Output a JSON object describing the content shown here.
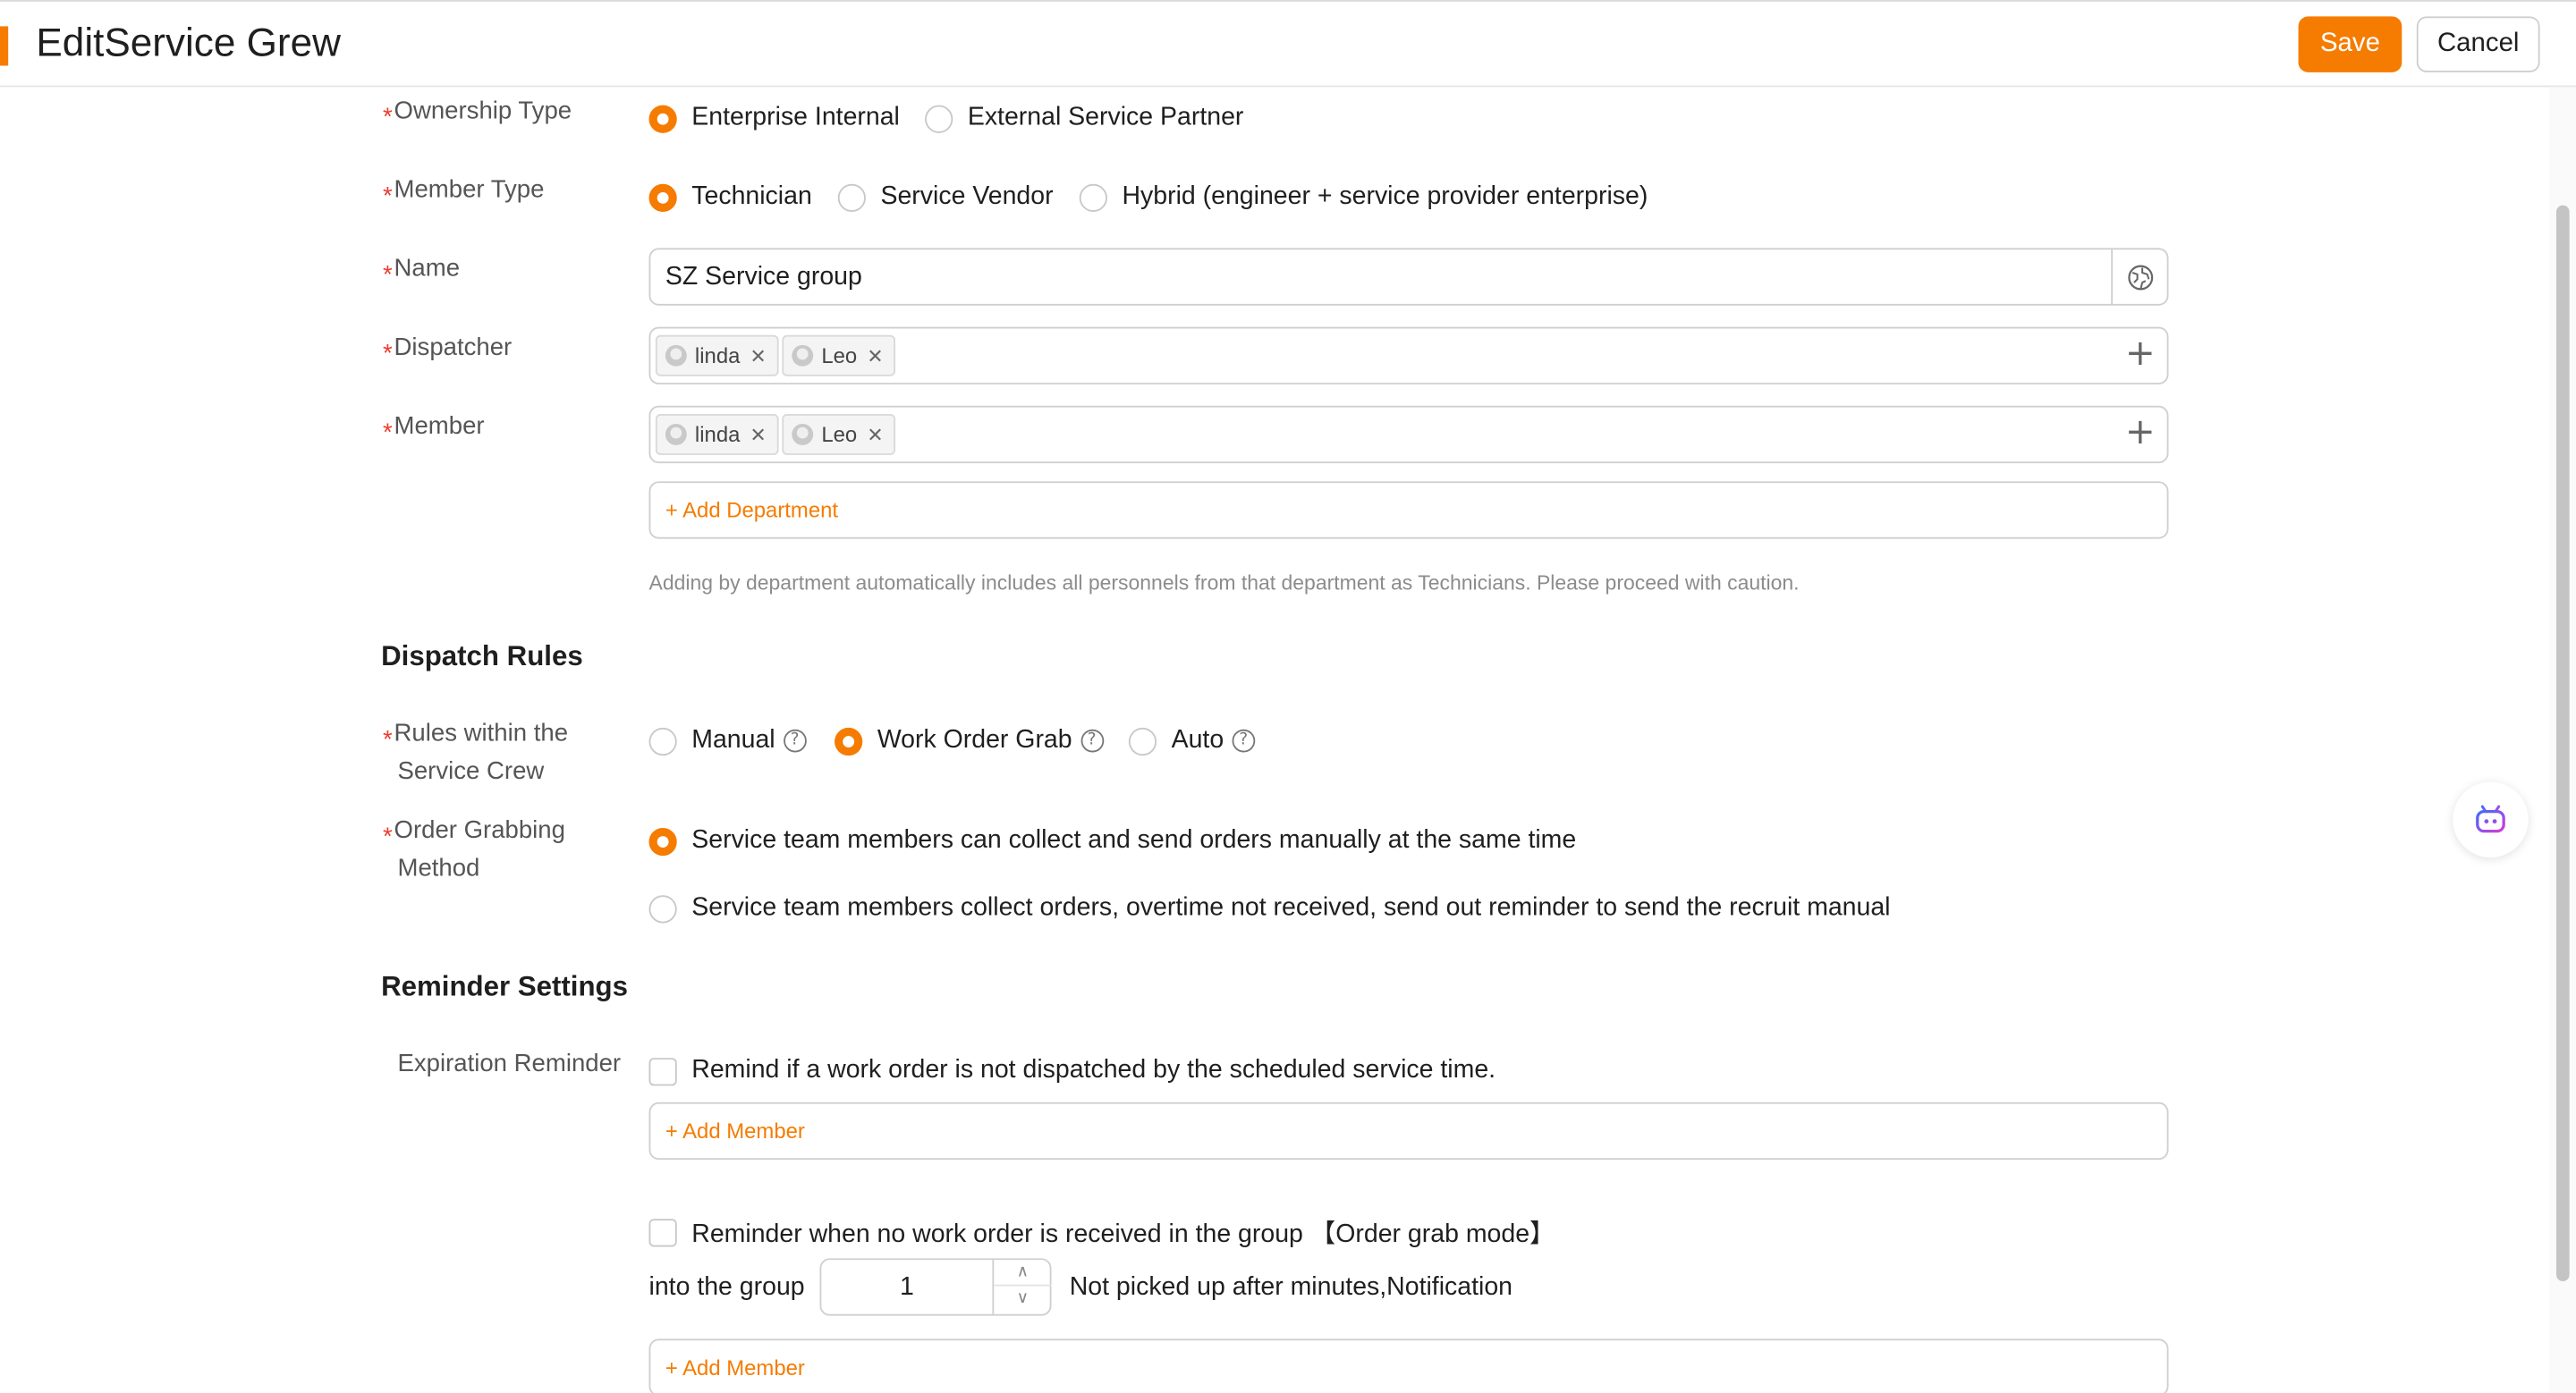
{
  "header": {
    "title": "EditService Grew",
    "save_label": "Save",
    "cancel_label": "Cancel"
  },
  "form": {
    "ownership_type": {
      "label": "Ownership Type",
      "options": [
        "Enterprise Internal",
        "External Service Partner"
      ],
      "selected": "Enterprise Internal"
    },
    "member_type": {
      "label": "Member Type",
      "options": [
        "Technician",
        "Service Vendor",
        "Hybrid (engineer + service provider enterprise)"
      ],
      "selected": "Technician"
    },
    "name": {
      "label": "Name",
      "value": "SZ Service group",
      "icon": "globe-icon"
    },
    "dispatcher": {
      "label": "Dispatcher",
      "tags": [
        "linda",
        "Leo"
      ]
    },
    "member": {
      "label": "Member",
      "tags": [
        "linda",
        "Leo"
      ],
      "add_department": "+ Add Department"
    },
    "department_hint": "Adding by department automatically includes all personnels from that department as Technicians. Please proceed with caution."
  },
  "dispatch_rules": {
    "title": "Dispatch Rules",
    "rules_label_line1": "Rules within the",
    "rules_label_line2": "Service Crew",
    "rules_options": [
      "Manual",
      "Work Order Grab",
      "Auto"
    ],
    "rules_selected": "Work Order Grab",
    "grab_label_line1": "Order Grabbing",
    "grab_label_line2": "Method",
    "grab_options": [
      "Service team members can collect and send orders manually at the same time",
      "Service team members collect orders, overtime not received, send out reminder to send the recruit manual"
    ],
    "grab_selected_index": 0
  },
  "reminder_settings": {
    "title": "Reminder Settings",
    "expiration_label": "Expiration Reminder",
    "expiration_check": "Remind if a work order is not dispatched by the scheduled service time.",
    "add_member_1": "+ Add Member",
    "group_check": "Reminder when no work order is received in the group 【Order grab mode】",
    "into_group": "into the group",
    "minutes_value": "1",
    "not_picked": "Not picked up after minutes,Notification",
    "add_member_2": "+ Add Member"
  },
  "colors": {
    "accent": "#f57c00",
    "required": "#ef3b2d",
    "border": "#cfcfcf"
  }
}
